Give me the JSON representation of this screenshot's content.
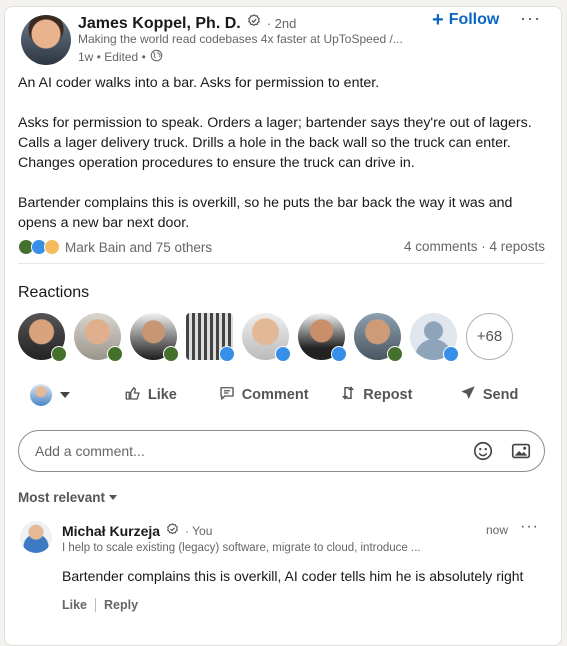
{
  "post": {
    "author_name": "James Koppel, Ph. D.",
    "degree": "· 2nd",
    "headline": "Making the world read codebases 4x faster at UpToSpeed /...",
    "time": "1w • Edited •",
    "follow_label": "Follow",
    "more_label": "···",
    "paragraphs": [
      "An AI coder walks into a bar. Asks for permission to enter.",
      "Asks for permission to speak. Orders a lager; bartender says they're out of lagers. Calls a lager delivery truck. Drills a hole in the back wall so the truck can enter. Changes operation procedures to ensure the truck can drive in.",
      "Bartender complains this is overkill, so he puts the bar back the way it was and opens a new bar next door."
    ],
    "reactions_summary": "Mark Bain and 75 others",
    "comments_reposts": "4 comments · 4 reposts"
  },
  "reactions": {
    "title": "Reactions",
    "more_count": "+68"
  },
  "actions": {
    "like": "Like",
    "comment": "Comment",
    "repost": "Repost",
    "send": "Send"
  },
  "comment_box": {
    "placeholder": "Add a comment..."
  },
  "sort": {
    "label": "Most relevant"
  },
  "comment": {
    "author": "Michał Kurzeja",
    "you_label": "· You",
    "headline": "I help to scale existing (legacy) software, migrate to cloud, introduce ...",
    "time": "now",
    "more_label": "···",
    "text": "Bartender complains this is overkill, AI coder tells him he is absolutely right",
    "like_label": "Like",
    "reply_label": "Reply"
  },
  "colors": {
    "accent": "#0a66c2",
    "like": "#378fe9",
    "celebrate": "#44712e",
    "support": "#d0a5c9"
  }
}
